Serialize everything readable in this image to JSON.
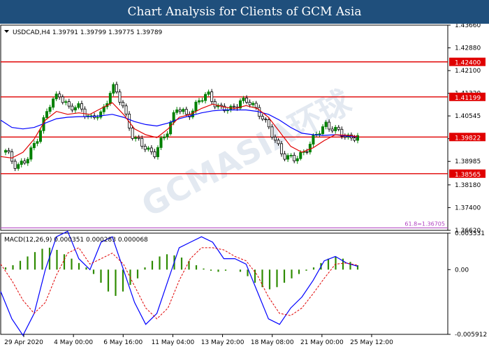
{
  "banner": {
    "title": "Chart Analysis for Clients of GCM Asia"
  },
  "watermark": {
    "text": "GCMASIA环球"
  },
  "colors": {
    "bull": "#008000",
    "bear": "#000000",
    "level": "#e00000",
    "fib": "#b040c0",
    "ma_fast": "#e00000",
    "ma_slow": "#0000ff",
    "macd_hist": "#2e8b00",
    "macd_line": "#0000ff",
    "signal_line": "#e00000"
  },
  "chart_data": [
    {
      "type": "candlestick",
      "info": "USDCAD,H4  1.39791 1.39799 1.39775 1.39789",
      "y_ticks": [
        "1.43660",
        "1.42880",
        "1.42100",
        "1.41320",
        "1.40545",
        "1.39765",
        "1.38985",
        "1.38180",
        "1.37400",
        "1.36620"
      ],
      "ylim": [
        1.3662,
        1.4366
      ],
      "levels": [
        {
          "label": "1.42400",
          "value": 1.424
        },
        {
          "label": "1.41199",
          "value": 1.41199
        },
        {
          "label": "1.39822",
          "value": 1.39822
        },
        {
          "label": "1.38565",
          "value": 1.38565
        }
      ],
      "fib": {
        "label": "61.8=1.36705",
        "value": 1.36705
      },
      "x_labels": [
        "29 Apr 2020",
        "4 May 00:00",
        "6 May 16:00",
        "11 May 04:00",
        "13 May 20:00",
        "18 May 08:00",
        "21 May 00:00",
        "25 May 12:00"
      ],
      "close_path": [
        1.393,
        1.3885,
        1.39,
        1.3985,
        1.408,
        1.4135,
        1.4075,
        1.409,
        1.404,
        1.4065,
        1.4155,
        1.409,
        1.3975,
        1.395,
        1.3925,
        1.399,
        1.4085,
        1.405,
        1.4105,
        1.4125,
        1.4085,
        1.407,
        1.411,
        1.4095,
        1.406,
        1.3985,
        1.3925,
        1.39,
        1.3935,
        1.398,
        1.403,
        1.4,
        1.3985,
        1.398
      ],
      "series": [
        {
          "name": "MA fast",
          "values": [
            1.3915,
            1.391,
            1.393,
            1.3975,
            1.404,
            1.407,
            1.406,
            1.4065,
            1.406,
            1.408,
            1.41,
            1.406,
            1.401,
            1.399,
            1.398,
            1.401,
            1.405,
            1.406,
            1.408,
            1.4095,
            1.4085,
            1.408,
            1.409,
            1.408,
            1.405,
            1.4,
            1.395,
            1.393,
            1.3945,
            1.397,
            1.399,
            1.3988,
            1.3984
          ]
        },
        {
          "name": "MA slow",
          "values": [
            1.404,
            1.4015,
            1.401,
            1.4015,
            1.403,
            1.4045,
            1.405,
            1.4052,
            1.4052,
            1.4055,
            1.406,
            1.405,
            1.4035,
            1.4025,
            1.402,
            1.403,
            1.4045,
            1.4055,
            1.4065,
            1.4072,
            1.4075,
            1.4075,
            1.4075,
            1.407,
            1.406,
            1.404,
            1.4015,
            1.3995,
            1.399,
            1.3988,
            1.399,
            1.3985,
            1.3983
          ]
        }
      ]
    },
    {
      "type": "bar",
      "info": "MACD(12,26,9)  0.000351  0.000283  0.000068",
      "y_ticks": [
        "0.003331",
        "0.00",
        "-0.005912"
      ],
      "ylim": [
        -0.005912,
        0.003331
      ],
      "histogram": [
        0.0002,
        0.0004,
        0.0008,
        0.0012,
        0.0016,
        0.0019,
        0.002,
        0.0018,
        0.0014,
        0.001,
        0.0006,
        0.0002,
        -0.0004,
        -0.0012,
        -0.002,
        -0.0024,
        -0.002,
        -0.0014,
        -0.0008,
        0.0002,
        0.0008,
        0.0012,
        0.0014,
        0.0013,
        0.0011,
        0.0008,
        0.0004,
        0.0001,
        -0.0001,
        -0.0002,
        -0.0001,
        0.0,
        -0.0002,
        -0.0006,
        -0.0012,
        -0.0016,
        -0.0018,
        -0.0016,
        -0.0012,
        -0.0008,
        -0.0004,
        -0.0001,
        0.0002,
        0.0006,
        0.001,
        0.0012,
        0.001,
        0.0007,
        0.0004
      ],
      "series": [
        {
          "name": "MACD",
          "values": [
            -0.002,
            -0.0045,
            -0.006,
            -0.004,
            0.0,
            0.003,
            0.0035,
            0.001,
            0.0,
            0.0025,
            0.003,
            0.0,
            -0.003,
            -0.005,
            -0.004,
            -0.001,
            0.002,
            0.0025,
            0.003,
            0.0025,
            0.001,
            0.001,
            0.0005,
            -0.002,
            -0.0045,
            -0.005,
            -0.0035,
            -0.0025,
            -0.001,
            0.0008,
            0.0012,
            0.0006,
            0.0003
          ]
        },
        {
          "name": "Signal",
          "values": [
            0.0005,
            -0.001,
            -0.0028,
            -0.004,
            -0.003,
            -0.0005,
            0.0015,
            0.002,
            0.0005,
            0.001,
            0.0015,
            0.0005,
            -0.0015,
            -0.0035,
            -0.0045,
            -0.0035,
            -0.001,
            0.001,
            0.002,
            0.002,
            0.0018,
            0.0012,
            0.0008,
            -0.0005,
            -0.0025,
            -0.004,
            -0.0042,
            -0.0035,
            -0.0022,
            -0.0008,
            0.0005,
            0.0006,
            0.0004
          ]
        }
      ]
    }
  ]
}
